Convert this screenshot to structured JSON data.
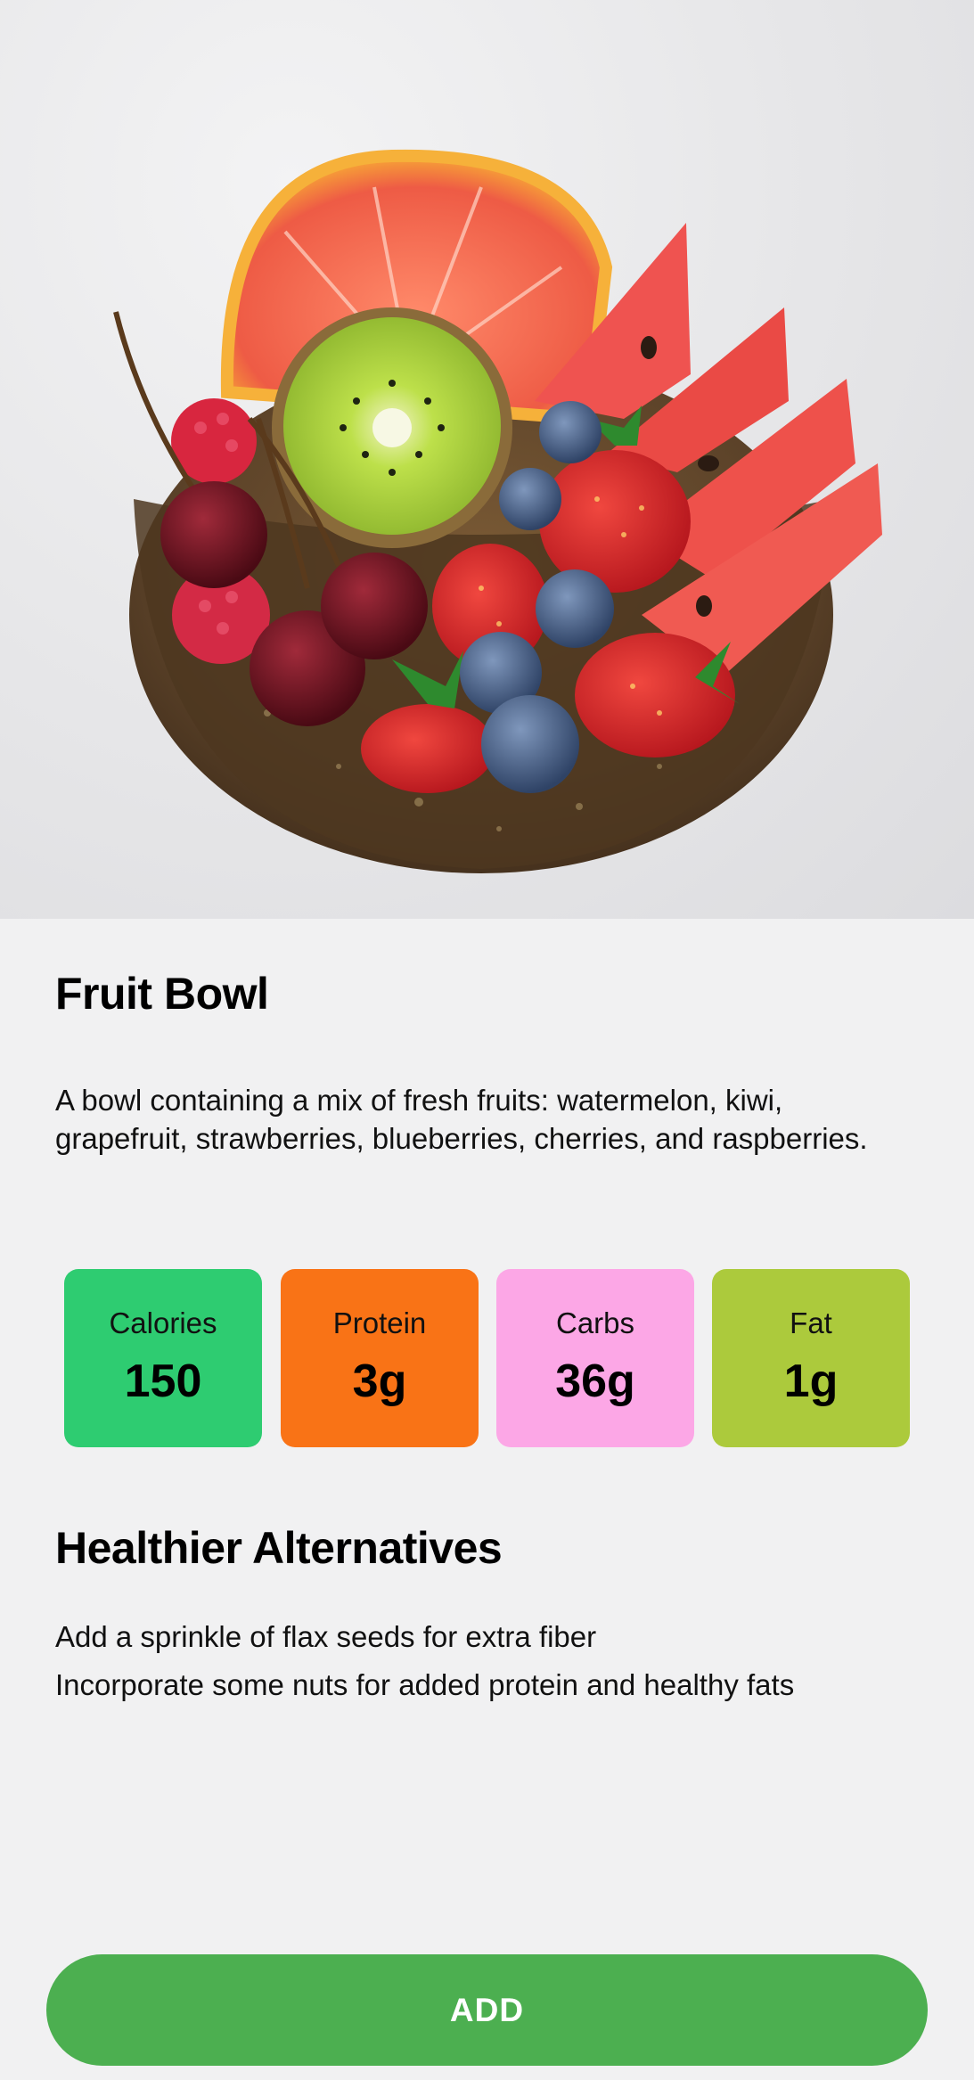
{
  "meal": {
    "title": "Fruit Bowl",
    "description": "A bowl containing a mix of fresh fruits: watermelon, kiwi, grapefruit, strawberries, blueberries, cherries, and raspberries."
  },
  "macros": [
    {
      "label": "Calories",
      "value": "150",
      "color": "#2ecc71"
    },
    {
      "label": "Protein",
      "value": "3g",
      "color": "#f97316"
    },
    {
      "label": "Carbs",
      "value": "36g",
      "color": "#fca7e6"
    },
    {
      "label": "Fat",
      "value": "1g",
      "color": "#acca3c"
    }
  ],
  "alternatives": {
    "title": "Healthier Alternatives",
    "items": [
      "Add a sprinkle of flax seeds for extra fiber",
      "Incorporate some nuts for added protein and healthy fats"
    ]
  },
  "actions": {
    "add_label": "ADD",
    "add_color": "#4caf50"
  }
}
